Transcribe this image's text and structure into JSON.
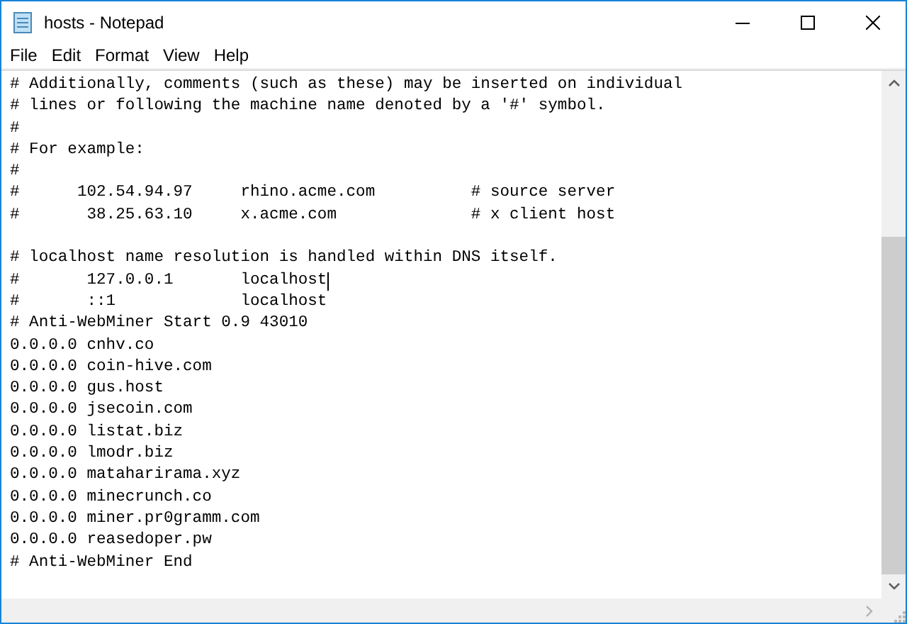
{
  "window": {
    "title": "hosts - Notepad"
  },
  "menu": [
    {
      "label": "File"
    },
    {
      "label": "Edit"
    },
    {
      "label": "Format"
    },
    {
      "label": "View"
    },
    {
      "label": "Help"
    }
  ],
  "editor": {
    "lines": [
      {
        "kind": "text",
        "text": "# Additionally, comments (such as these) may be inserted on individual",
        "caret": false
      },
      {
        "kind": "text",
        "text": "# lines or following the machine name denoted by a '#' symbol.",
        "caret": false
      },
      {
        "kind": "text",
        "text": "#",
        "caret": false
      },
      {
        "kind": "text",
        "text": "# For example:",
        "caret": false
      },
      {
        "kind": "text",
        "text": "#",
        "caret": false
      },
      {
        "kind": "text",
        "text": "#      102.54.94.97     rhino.acme.com          # source server",
        "caret": false
      },
      {
        "kind": "text",
        "text": "#       38.25.63.10     x.acme.com              # x client host",
        "caret": false
      },
      {
        "kind": "blank",
        "caret": false
      },
      {
        "kind": "text",
        "text": "# localhost name resolution is handled within DNS itself.",
        "caret": false
      },
      {
        "kind": "text",
        "text": "#       127.0.0.1       localhost",
        "caret": true
      },
      {
        "kind": "text",
        "text": "#       ::1             localhost",
        "caret": false
      },
      {
        "kind": "text",
        "text": "# Anti-WebMiner Start 0.9 43010",
        "caret": false
      },
      {
        "kind": "text",
        "text": "0.0.0.0 cnhv.co",
        "caret": false
      },
      {
        "kind": "text",
        "text": "0.0.0.0 coin-hive.com",
        "caret": false
      },
      {
        "kind": "text",
        "text": "0.0.0.0 gus.host",
        "caret": false
      },
      {
        "kind": "text",
        "text": "0.0.0.0 jsecoin.com",
        "caret": false
      },
      {
        "kind": "text",
        "text": "0.0.0.0 listat.biz",
        "caret": false
      },
      {
        "kind": "text",
        "text": "0.0.0.0 lmodr.biz",
        "caret": false
      },
      {
        "kind": "text",
        "text": "0.0.0.0 mataharirama.xyz",
        "caret": false
      },
      {
        "kind": "text",
        "text": "0.0.0.0 minecrunch.co",
        "caret": false
      },
      {
        "kind": "text",
        "text": "0.0.0.0 miner.pr0gramm.com",
        "caret": false
      },
      {
        "kind": "text",
        "text": "0.0.0.0 reasedoper.pw",
        "caret": false
      },
      {
        "kind": "text",
        "text": "# Anti-WebMiner End",
        "caret": false
      }
    ]
  }
}
